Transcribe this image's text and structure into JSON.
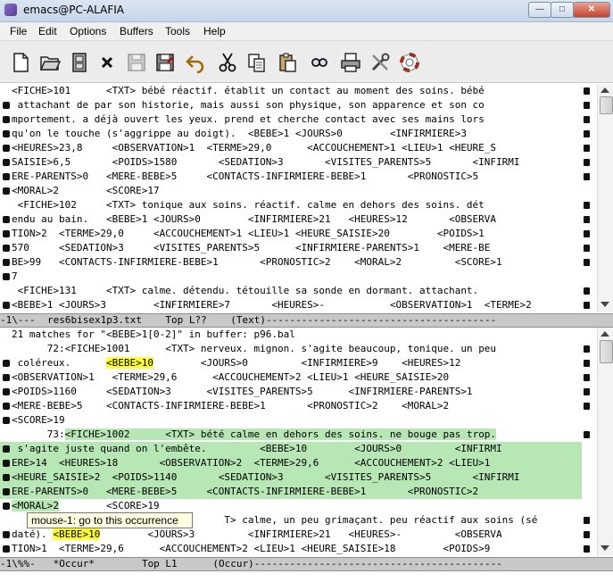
{
  "window": {
    "title": "emacs@PC-ALAFIA"
  },
  "menu": {
    "items": [
      "File",
      "Edit",
      "Options",
      "Buffers",
      "Tools",
      "Help"
    ]
  },
  "toolbar": {
    "icons": [
      "new-file-icon",
      "open-folder-icon",
      "dired-cabinet-icon",
      "close-buffer-icon",
      "save-icon",
      "save-as-icon",
      "undo-icon",
      "cut-icon",
      "copy-icon",
      "paste-icon",
      "search-icon",
      "print-icon",
      "preferences-icon",
      "help-lifebuoy-icon"
    ]
  },
  "top_buffer": {
    "lines": [
      "<FICHE>101      <TXT> bébé réactif. établit un contact au moment des soins. bébé",
      " attachant de par son historie, mais aussi son physique, son apparence et son co",
      "mportement. a déjà ouvert les yeux. prend et cherche contact avec ses mains lors",
      "qu'on le touche (s'aggrippe au doigt).  <BEBE>1 <JOURS>0        <INFIRMIERE>3",
      "<HEURES>23,8     <OBSERVATION>1  <TERME>29,0      <ACCOUCHEMENT>1 <LIEU>1 <HEURE_S",
      "SAISIE>6,5       <POIDS>1580       <SEDATION>3       <VISITES_PARENTS>5       <INFIRMI",
      "ERE-PARENTS>0   <MERE-BEBE>5     <CONTACTS-INFIRMIERE-BEBE>1       <PRONOSTIC>5",
      "<MORAL>2        <SCORE>17",
      " <FICHE>102     <TXT> tonique aux soins. réactif. calme en dehors des soins. dét",
      "endu au bain.   <BEBE>1 <JOURS>0        <INFIRMIERE>21   <HEURES>12       <OBSERVA",
      "TION>2  <TERME>29,0     <ACCOUCHEMENT>1 <LIEU>1 <HEURE_SAISIE>20        <POIDS>1",
      "570     <SEDATION>3     <VISITES_PARENTS>5      <INFIRMIERE-PARENTS>1    <MERE-BE",
      "BE>99   <CONTACTS-INFIRMIERE-BEBE>1       <PRONOSTIC>2    <MORAL>2         <SCORE>1",
      "7",
      " <FICHE>131     <TXT> calme. détendu. tétouille sa sonde en dormant. attachant.",
      "<BEBE>1 <JOURS>3        <INFIRMIERE>7       <HEURES>-           <OBSERVATION>1  <TERME>2"
    ]
  },
  "top_modeline": "-1\\---  res6bisex1p3.txt    Top L??    (Text)---------------------------------------",
  "occur": {
    "header": "21 matches for \"<BEBE>1[0-2]\" in buffer: p96.bal",
    "m72_prefix": "      72:",
    "m72_a": "<FICHE>1001      <TXT> nerveux. mignon. s'agite beaucoup, tonique. un peu",
    "m72_b_pre": " coléreux.      ",
    "bebe": "<BEBE>10",
    "m72_b_post": "        <JOURS>0         <INFIRMIERE>9    <HEURES>12",
    "m72_c": "<OBSERVATION>1   <TERME>29,6      <ACCOUCHEMENT>2 <LIEU>1 <HEURE_SAISIE>20",
    "m72_d": "<POIDS>1160     <SEDATION>3      <VISITES_PARENTS>5      <INFIRMIERE-PARENTS>1",
    "m72_e": "<MERE-BEBE>5    <CONTACTS-INFIRMIERE-BEBE>1       <PRONOSTIC>2    <MORAL>2",
    "m72_f": "<SCORE>19",
    "m73_prefix": "      73:",
    "m73_a": "<FICHE>1002      <TXT> bété calme en dehors des soins. ne bouge pas trop.",
    "m73_b": " s'agite juste quand on l'embête.         <BEBE>10        <JOURS>0         <INFIRMI",
    "m73_c": "ERE>14  <HEURES>18       <OBSERVATION>2  <TERME>29,6      <ACCOUCHEMENT>2 <LIEU>1",
    "m73_d": "<HEURE_SAISIE>2  <POIDS>1140       <SEDATION>3       <VISITES_PARENTS>5       <INFIRMI",
    "m73_e": "ERE-PARENTS>0   <MERE-BEBE>5     <CONTACTS-INFIRMIERE-BEBE>1       <PRONOSTIC>2",
    "m73_f_hl": "<MORAL>2",
    "m73_f_rest": "        <SCORE>19",
    "m74_a": "                                    T> calme, un peu grimaçant. peu réactif aux soins (sé",
    "m74_b_pre": "daté). ",
    "m74_b_post": "        <JOURS>3         <INFIRMIERE>21   <HEURES>-         <OBSERVA",
    "m74_c": "TION>1  <TERME>29,6      <ACCOUCHEMENT>2 <LIEU>1 <HEURE_SAISIE>18        <POIDS>9"
  },
  "bottom_modeline": "-1\\%%-   *Occur*        Top L1      (Occur)------------------------------------------",
  "tooltip": "mouse-1: go to this occurrence"
}
